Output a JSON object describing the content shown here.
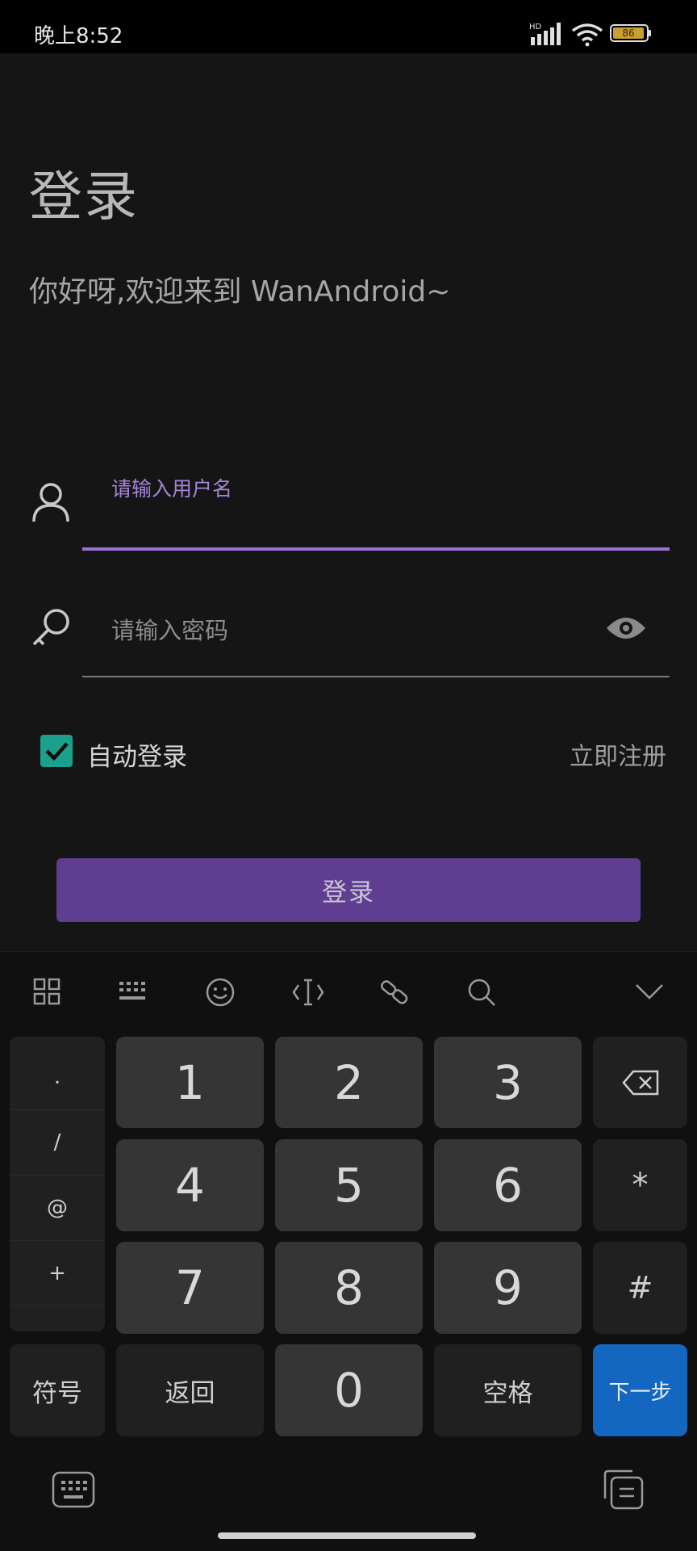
{
  "status_bar": {
    "time": "晚上8:52",
    "network_type": "HD",
    "battery": "86"
  },
  "login": {
    "title": "登录",
    "welcome": "你好呀,欢迎来到 WanAndroid~",
    "username_placeholder": "请输入用户名",
    "password_placeholder": "请输入密码",
    "auto_login_label": "自动登录",
    "auto_login_checked": true,
    "register_label": "立即注册",
    "login_button": "登录"
  },
  "keyboard": {
    "toolbar_icons": [
      "grid-icon",
      "keyboard-layout-icon",
      "emoji-icon",
      "cursor-icon",
      "link-icon",
      "search-icon",
      "collapse-chevron-icon"
    ],
    "symbols": [
      ".",
      "/",
      "@",
      "+"
    ],
    "digits": [
      "1",
      "2",
      "3",
      "4",
      "5",
      "6",
      "7",
      "8",
      "9",
      "0"
    ],
    "star": "*",
    "hash": "#",
    "symbol_key": "符号",
    "back_key": "返回",
    "space_key": "空格",
    "next_key": "下一步"
  },
  "colors": {
    "accent": "#9a73d4",
    "button": "#5f3e91",
    "checkbox": "#1aa08c",
    "next_key": "#1467c0"
  }
}
